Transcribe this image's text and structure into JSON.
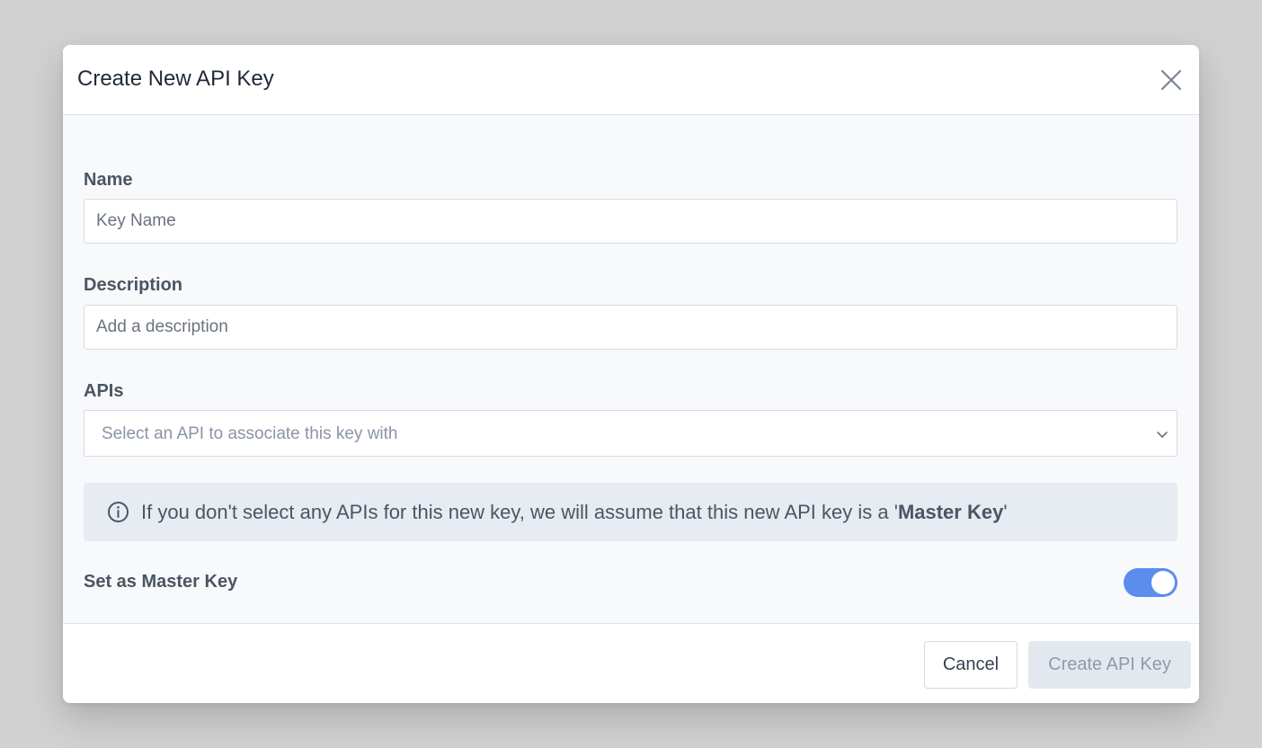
{
  "modal": {
    "title": "Create New API Key"
  },
  "form": {
    "name": {
      "label": "Name",
      "placeholder": "Key Name",
      "value": ""
    },
    "description": {
      "label": "Description",
      "placeholder": "Add a description",
      "value": ""
    },
    "apis": {
      "label": "APIs",
      "placeholder": "Select an API to associate this key with"
    },
    "info": {
      "text_before": "If you don't select any APIs for this new key, we will assume that this new API key is a '",
      "emphasis": "Master Key",
      "text_after": "'"
    },
    "master_key": {
      "label": "Set as Master Key",
      "enabled": true
    }
  },
  "footer": {
    "cancel_label": "Cancel",
    "create_label": "Create API Key"
  },
  "colors": {
    "accent": "#5b8def",
    "backdrop": "#d1d1d1",
    "info_background": "#e7ecf2",
    "disabled_button": "#e3e8ee"
  },
  "icons": {
    "close": "close-icon",
    "info": "info-icon",
    "chevron": "chevron-down-icon"
  }
}
